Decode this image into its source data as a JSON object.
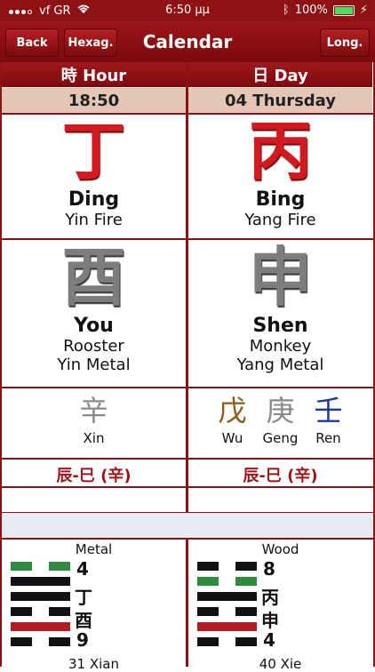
{
  "status": {
    "carrier": "vf GR",
    "time": "6:50 μμ",
    "battery": "100%"
  },
  "nav": {
    "title": "Calendar",
    "back": "Back",
    "hexag": "Hexag.",
    "long": "Long."
  },
  "columns": [
    {
      "header": "時 Hour",
      "value": "18:50",
      "stem_char": "丁",
      "stem_name": "Ding",
      "stem_element": "Yin Fire",
      "branch_char": "酉",
      "branch_name": "You",
      "branch_animal": "Rooster",
      "branch_element": "Yin Metal",
      "hidden_stems": [
        {
          "char": "辛",
          "name": "Xin"
        }
      ],
      "relation": "辰-巳 (辛)",
      "hex_element": "Metal",
      "hex_marks": [
        "4",
        "丁",
        "酉",
        "9"
      ],
      "hex_name": "31 Xian"
    },
    {
      "header": "日 Day",
      "value": "04 Thursday",
      "stem_char": "丙",
      "stem_name": "Bing",
      "stem_element": "Yang Fire",
      "branch_char": "申",
      "branch_name": "Shen",
      "branch_animal": "Monkey",
      "branch_element": "Yang Metal",
      "hidden_stems": [
        {
          "char": "戊",
          "name": "Wu"
        },
        {
          "char": "庚",
          "name": "Geng"
        },
        {
          "char": "壬",
          "name": "Ren"
        }
      ],
      "relation": "辰-巳 (辛)",
      "hex_element": "Wood",
      "hex_marks": [
        "8",
        "丙",
        "申",
        "4"
      ],
      "hex_name": "40 Xie"
    }
  ],
  "colors": {
    "primary": "#8e1114",
    "accent_red": "#d21a1f",
    "green": "#2e8b3e"
  }
}
